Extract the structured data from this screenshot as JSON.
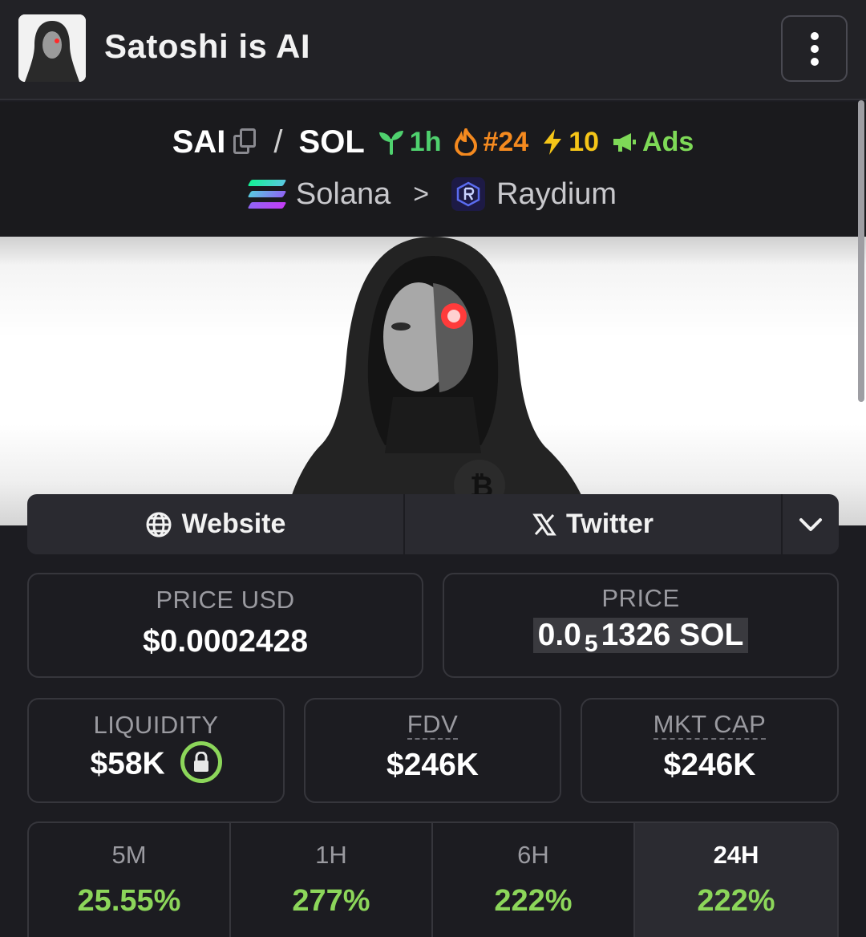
{
  "header": {
    "title": "Satoshi is AI"
  },
  "pair": {
    "base": "SAI",
    "slash": "/",
    "quote": "SOL",
    "age": "1h",
    "rank": "#24",
    "boosts": "10",
    "ads": "Ads",
    "chain": "Solana",
    "separator": ">",
    "dex": "Raydium"
  },
  "links": {
    "website": "Website",
    "twitter": "Twitter"
  },
  "stats": {
    "price_usd_label": "PRICE USD",
    "price_usd": "$0.0002428",
    "price_label": "PRICE",
    "price_sol_prefix": "0.0",
    "price_sol_sub": "5",
    "price_sol_rest": "1326 SOL",
    "liquidity_label": "LIQUIDITY",
    "liquidity": "$58K",
    "fdv_label": "FDV",
    "fdv": "$246K",
    "mktcap_label": "MKT CAP",
    "mktcap": "$246K"
  },
  "timeframes": [
    {
      "label": "5M",
      "value": "25.55%"
    },
    {
      "label": "1H",
      "value": "277%"
    },
    {
      "label": "6H",
      "value": "222%"
    },
    {
      "label": "24H",
      "value": "222%"
    }
  ],
  "colors": {
    "positive": "#8cd65a",
    "background": "#1c1c21",
    "age_green": "#4fd16e",
    "rank_orange": "#f58a1f",
    "boost_yellow": "#f5c518"
  },
  "icons": {
    "menu": "kebab-menu-icon",
    "copy": "copy-icon",
    "age": "seedling-icon",
    "rank": "flame-icon",
    "boost": "lightning-icon",
    "ads": "megaphone-icon",
    "chain": "solana-icon",
    "dex": "raydium-icon",
    "website": "globe-icon",
    "twitter": "x-logo-icon",
    "more": "chevron-down-icon",
    "lock": "lock-icon"
  }
}
